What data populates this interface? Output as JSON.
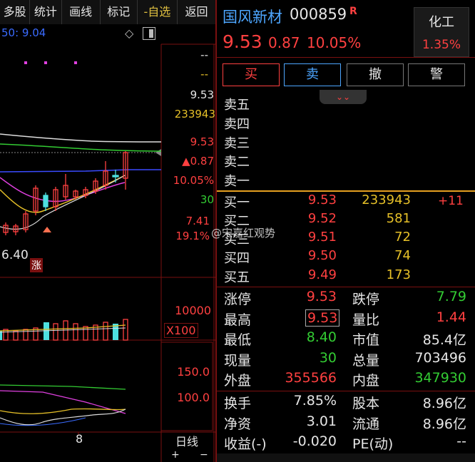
{
  "toolbar": {
    "items": [
      "多股",
      "统计",
      "画线",
      "标记",
      "-自选",
      "返回"
    ]
  },
  "chart": {
    "ma_label": "50: 9.04",
    "axis_price": [
      "--",
      "--",
      "9.53",
      "233943",
      "9.53",
      "▲0.87",
      "10.05%",
      "30",
      "7.41",
      "19.1%"
    ],
    "low_label": "6.40",
    "zhang_badge": "涨",
    "vol_axis_top": "10000",
    "vol_axis_unit": "X100",
    "ind_axis_top": "150.0",
    "ind_axis_mid": "100.0",
    "date_label": "8",
    "period": "日线",
    "zoom_in": "+",
    "zoom_out": "−"
  },
  "stock": {
    "name": "国风新材",
    "code": "000859",
    "badge": "R",
    "price": "9.53",
    "change": "0.87",
    "change_pct": "10.05%",
    "sector": "化工",
    "sector_pct": "1.35%"
  },
  "actions": [
    "买",
    "卖",
    "撤",
    "警"
  ],
  "orderbook": {
    "asks": [
      {
        "label": "卖五",
        "price": "",
        "vol": ""
      },
      {
        "label": "卖四",
        "price": "",
        "vol": ""
      },
      {
        "label": "卖三",
        "price": "",
        "vol": ""
      },
      {
        "label": "卖二",
        "price": "",
        "vol": ""
      },
      {
        "label": "卖一",
        "price": "",
        "vol": ""
      }
    ],
    "bids": [
      {
        "label": "买一",
        "price": "9.53",
        "vol": "233943",
        "delta": "+11"
      },
      {
        "label": "买二",
        "price": "9.52",
        "vol": "581",
        "delta": ""
      },
      {
        "label": "买三",
        "price": "9.51",
        "vol": "72",
        "delta": ""
      },
      {
        "label": "买四",
        "price": "9.50",
        "vol": "74",
        "delta": ""
      },
      {
        "label": "买五",
        "price": "9.49",
        "vol": "173",
        "delta": ""
      }
    ]
  },
  "watermark": "@宋嘉红观势",
  "stats": [
    {
      "l1": "涨停",
      "v1": "9.53",
      "c1": "#ff4040",
      "l2": "跌停",
      "v2": "7.79",
      "c2": "#33cc33"
    },
    {
      "l1": "最高",
      "v1": "9.53",
      "c1": "#ff4040",
      "l2": "量比",
      "v2": "1.44",
      "c2": "#ff4040"
    },
    {
      "l1": "最低",
      "v1": "8.40",
      "c1": "#33cc33",
      "l2": "市值",
      "v2": "85.4亿",
      "c2": "#e6e6e6"
    },
    {
      "l1": "现量",
      "v1": "30",
      "c1": "#33cc33",
      "l2": "总量",
      "v2": "703496",
      "c2": "#e6e6e6"
    },
    {
      "l1": "外盘",
      "v1": "355566",
      "c1": "#ff4040",
      "l2": "内盘",
      "v2": "347930",
      "c2": "#33cc33"
    }
  ],
  "stats2": [
    {
      "l1": "换手",
      "v1": "7.85%",
      "l2": "股本",
      "v2": "8.96亿"
    },
    {
      "l1": "净资",
      "v1": "3.01",
      "l2": "流通",
      "v2": "8.96亿"
    },
    {
      "l1": "收益(-)",
      "v1": "-0.020",
      "l2": "PE(动)",
      "v2": "--"
    }
  ]
}
